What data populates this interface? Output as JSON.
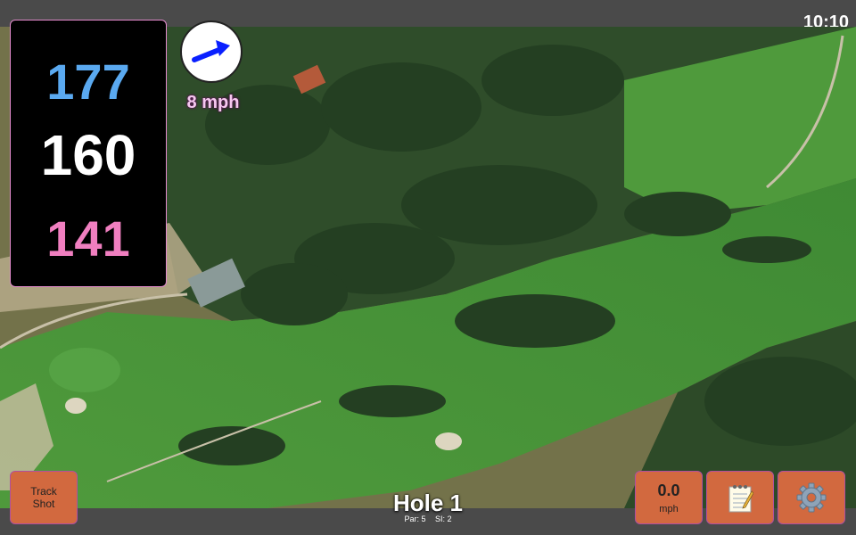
{
  "status_bar": {
    "time": "10:10"
  },
  "distances": {
    "back": "177",
    "middle": "160",
    "front": "141"
  },
  "wind": {
    "speed_label": "8 mph",
    "icon": "wind-direction-arrow-icon",
    "direction": "east-northeast"
  },
  "buttons": {
    "track_shot_line1": "Track",
    "track_shot_line2": "Shot",
    "speed_value": "0.0",
    "speed_unit": "mph",
    "notes_icon": "notepad-icon",
    "settings_icon": "gear-icon"
  },
  "hole": {
    "title": "Hole 1",
    "par": "Par: 5",
    "si": "SI: 2"
  },
  "colors": {
    "back": "#5aa9f0",
    "middle": "#ffffff",
    "front": "#f07fc0",
    "button": "#d2693f",
    "wind_label": "#f5c8ef"
  }
}
